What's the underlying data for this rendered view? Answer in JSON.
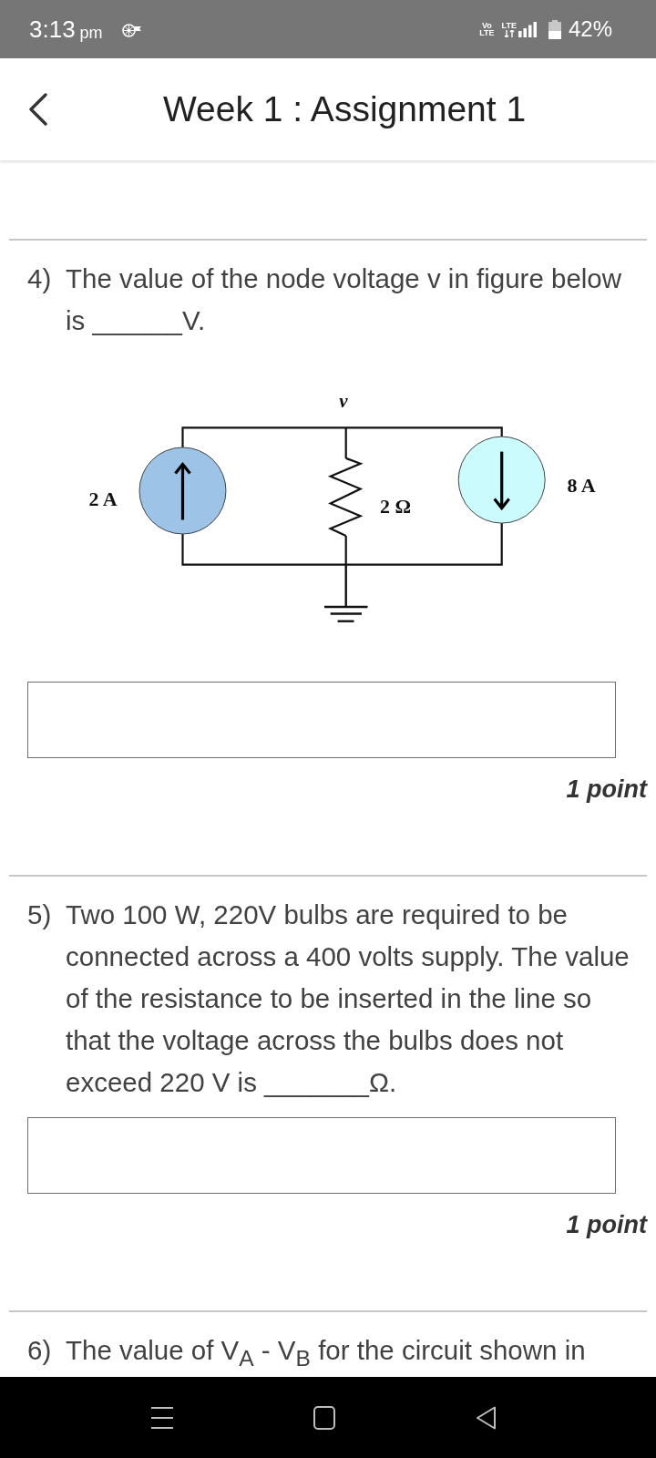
{
  "status_bar": {
    "time": "3:13",
    "period": "pm",
    "volte": "Vo LTE",
    "network": "LTE",
    "battery": "42%"
  },
  "header": {
    "title": "Week 1 : Assignment 1"
  },
  "questions": [
    {
      "number": "4)",
      "text": "The value of the node voltage v in figure below is ______V.",
      "figure": {
        "node_label": "v",
        "resistor_label": "2 Ω",
        "sources": [
          {
            "label": "2 A",
            "kind": "up",
            "color": "#9dc3e6"
          },
          {
            "label": "8 A",
            "kind": "down",
            "color": "#ccfbfd"
          }
        ]
      },
      "answer_box": true,
      "points": "1 point"
    },
    {
      "number": "5)",
      "text": "Two 100 W, 220V bulbs are required to be connected across a 400 volts supply. The value of the resistance to be inserted in the line so that the voltage across the bulbs does not exceed 220 V is _______Ω.",
      "answer_box": true,
      "points": "1 point"
    },
    {
      "number": "6)",
      "text": "The value of V$_{A}$ - V$_{B}$ for the circuit shown in"
    }
  ]
}
